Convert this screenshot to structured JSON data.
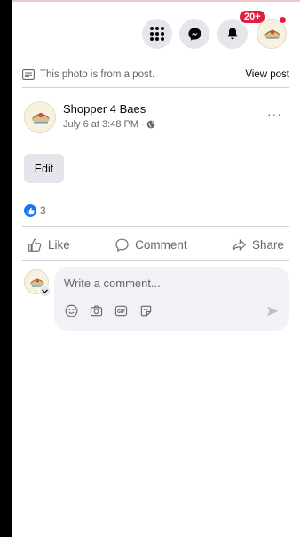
{
  "topbar": {
    "notification_count": "20+",
    "icons": [
      "menu-grid-icon",
      "messenger-icon",
      "bell-icon",
      "profile-avatar"
    ]
  },
  "post_source": {
    "text": "This photo is from a post.",
    "link": "View post"
  },
  "post": {
    "author": "Shopper 4 Baes",
    "time": "July 6 at 3:48 PM ·",
    "more": "···",
    "edit_label": "Edit",
    "reaction_count": "3"
  },
  "actions": {
    "like": "Like",
    "comment": "Comment",
    "share": "Share"
  },
  "composer": {
    "placeholder": "Write a comment..."
  },
  "colors": {
    "accent": "#1877f2",
    "badge": "#e41e3f",
    "button_bg": "#e4e6eb",
    "secondary_text": "#65676b"
  }
}
